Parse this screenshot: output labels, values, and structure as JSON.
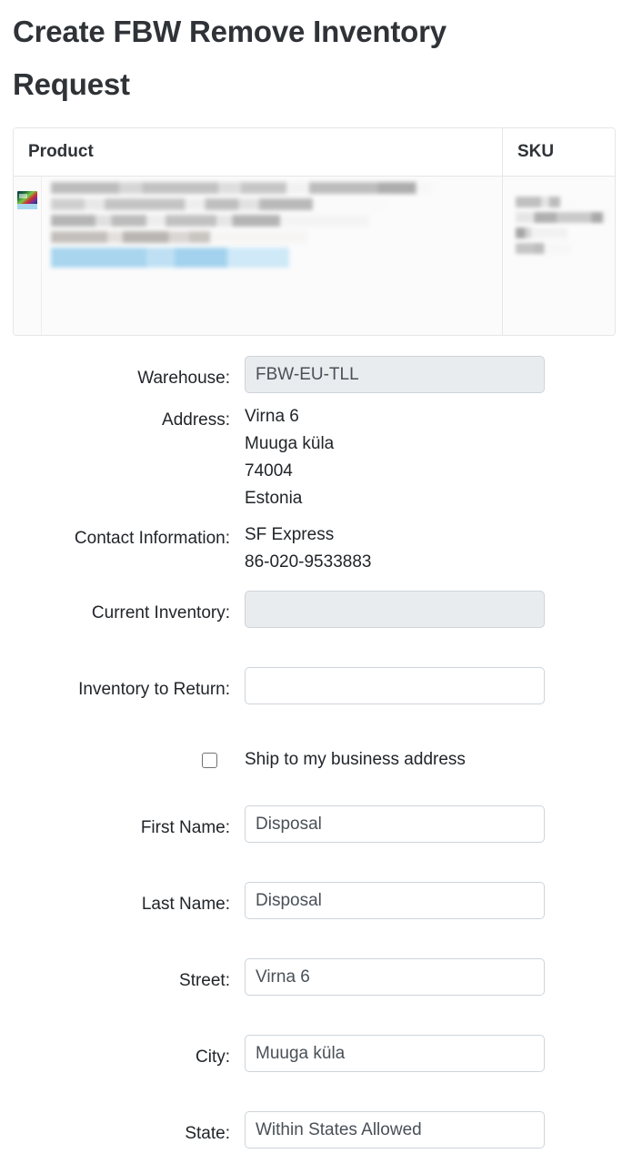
{
  "page": {
    "title": "Create FBW Remove Inventory Request"
  },
  "product_table": {
    "columns": [
      "Product",
      "SKU"
    ],
    "rows": [
      {
        "thumbnail": "product-thumbnail-image",
        "product": "[redacted]",
        "sku": "[redacted]"
      }
    ]
  },
  "form": {
    "warehouse": {
      "label": "Warehouse:",
      "value": "FBW-EU-TLL",
      "disabled": true
    },
    "address": {
      "label": "Address:",
      "lines": [
        "Virna 6",
        "Muuga küla",
        "74004",
        "Estonia"
      ],
      "line1": "Virna 6",
      "line2": "Muuga küla",
      "line3": "74004",
      "line4": "Estonia"
    },
    "contact_information": {
      "label": "Contact Information:",
      "lines": [
        "SF Express",
        "86-020-9533883"
      ],
      "line1": "SF Express",
      "line2": "86-020-9533883"
    },
    "current_inventory": {
      "label": "Current Inventory:",
      "value": "",
      "disabled": true
    },
    "inventory_to_return": {
      "label": "Inventory to Return:",
      "value": "",
      "placeholder": ""
    },
    "ship_to_business_address": {
      "label": "Ship to my business address",
      "checked": false
    },
    "first_name": {
      "label": "First Name:",
      "value": "Disposal"
    },
    "last_name": {
      "label": "Last Name:",
      "value": "Disposal"
    },
    "street": {
      "label": "Street:",
      "value": "Virna 6"
    },
    "city": {
      "label": "City:",
      "value": "Muuga küla"
    },
    "state": {
      "label": "State:",
      "value": "Within States Allowed"
    }
  },
  "colors": {
    "title_text": "#2f3337",
    "body_text": "#212529",
    "field_border": "#ced4da",
    "field_disabled_bg": "#e9ecef",
    "table_border": "#e4e6e8",
    "table_row_bg": "#fbfbfb"
  }
}
